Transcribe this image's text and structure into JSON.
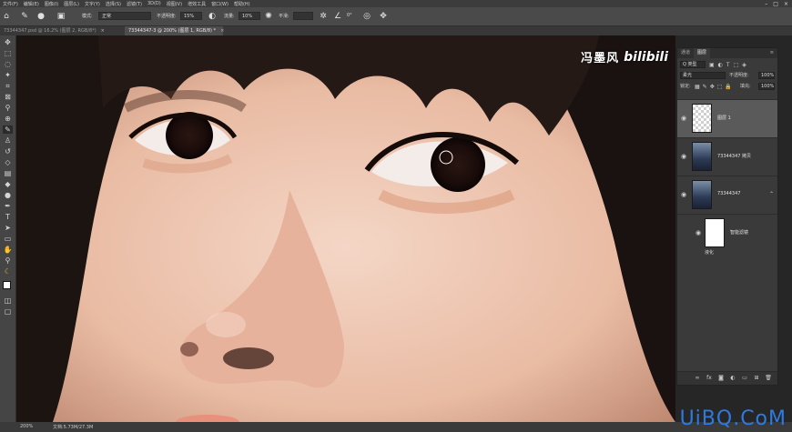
{
  "menu": [
    "文件(F)",
    "编辑(E)",
    "图像(I)",
    "图层(L)",
    "文字(Y)",
    "选择(S)",
    "滤镜(T)",
    "3D(D)",
    "视图(V)",
    "增效工具",
    "窗口(W)",
    "帮助(H)"
  ],
  "window_controls": [
    "–",
    "□",
    "×"
  ],
  "options": {
    "mode_label": "模式:",
    "mode_value": "正常",
    "opacity_label": "不透明度:",
    "opacity_value": "15%",
    "flow_label": "流量:",
    "flow_value": "10%",
    "smooth_label": "平滑:",
    "angle_value": "0°"
  },
  "tabs": [
    {
      "label": "7334434​7.psd @ 16.2% (图层 2, RGB/8*)"
    },
    {
      "label": "73344347-3 @ 200% (图层 1, RGB/8) *"
    }
  ],
  "watermark": {
    "name": "冯墨风",
    "brand": "bilibili"
  },
  "layers_panel": {
    "tabs": [
      "通道",
      "图层"
    ],
    "kind_label": "Q 类型",
    "blend_mode": "柔光",
    "opacity_label": "不透明度:",
    "opacity_value": "100%",
    "lock_label": "锁定:",
    "fill_label": "填充:",
    "fill_value": "100%",
    "layers": [
      {
        "name": "图层 1"
      },
      {
        "name": "73344347 拷贝"
      },
      {
        "name": "73344347"
      },
      {
        "name": "智能滤镜"
      }
    ],
    "filter_item": "液化"
  },
  "status": {
    "zoom": "200%",
    "doc": "文档:5.73M/27.3M"
  },
  "site_watermark": "UiBQ.CoM"
}
